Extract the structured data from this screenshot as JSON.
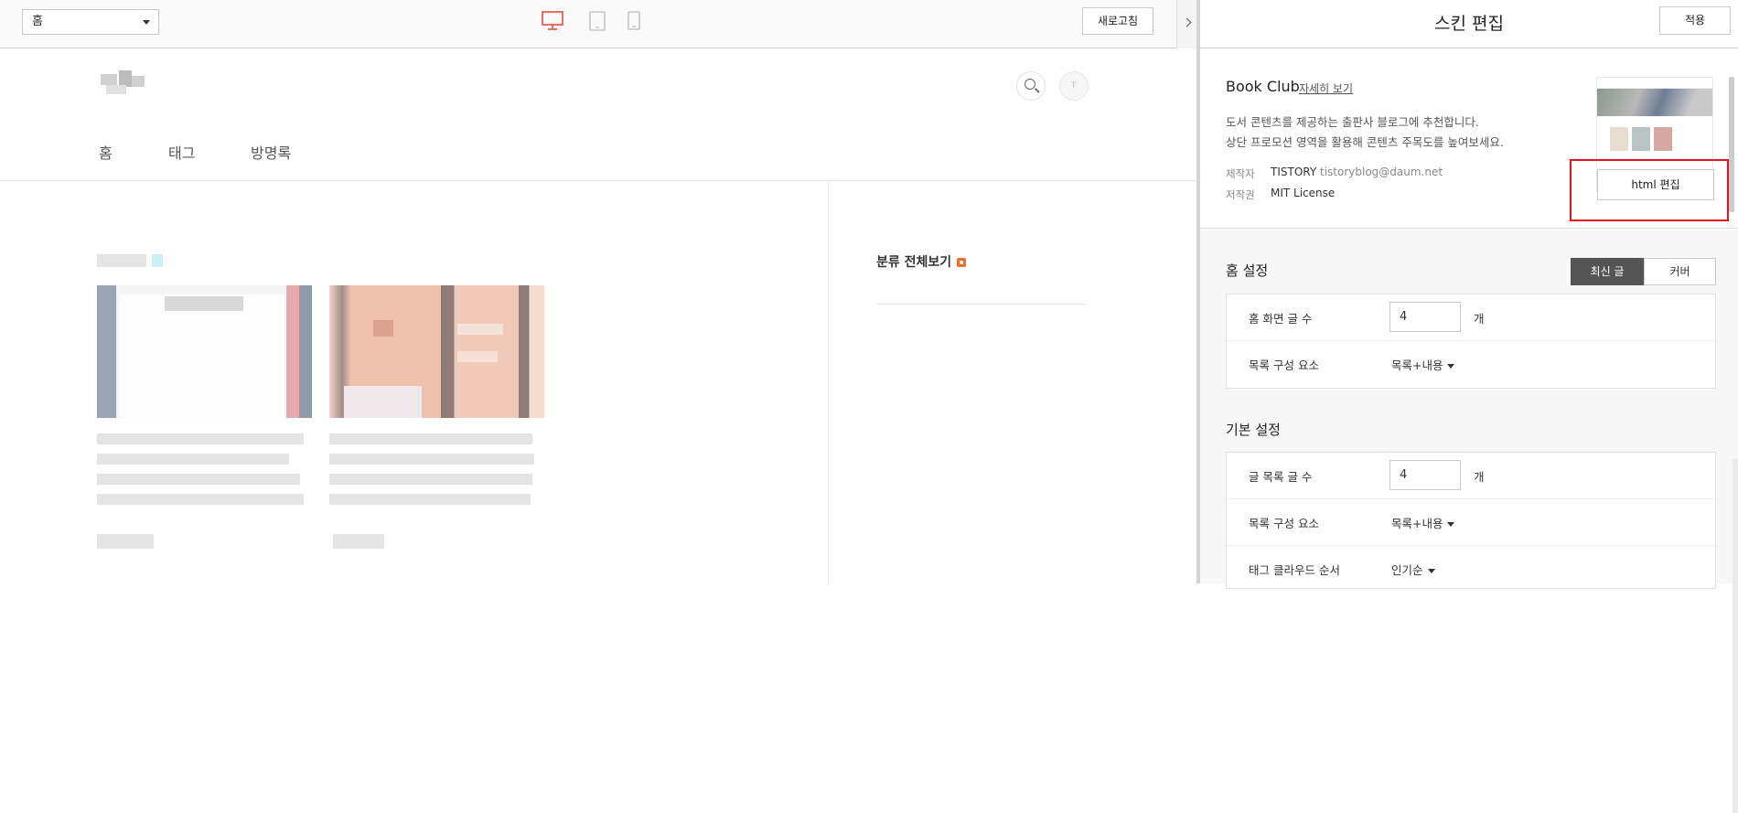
{
  "toolbar": {
    "page_select_value": "홈",
    "refresh_label": "새로고침",
    "device_icons": [
      "desktop-icon",
      "tablet-icon",
      "mobile-icon"
    ],
    "active_device_color": "#e84a3f"
  },
  "blog": {
    "nav": [
      "홈",
      "태그",
      "방명록"
    ],
    "sidebar_category_label": "분류 전체보기",
    "rss_color": "#f26f2c"
  },
  "panel": {
    "title": "스킨 편집",
    "apply_label": "적용",
    "skin": {
      "name": "Book Club",
      "detail_link": "자세히 보기",
      "desc1": "도서 콘텐츠를 제공하는 출판사 블로그에 추천합니다.",
      "desc2": "상단 프로모션 영역을 활용해 콘텐츠 주목도를 높여보세요.",
      "maker_label": "제작자",
      "maker_name": "TISTORY",
      "maker_email": "tistoryblog@daum.net",
      "license_label": "저작권",
      "license_value": "MIT License",
      "html_edit_label": "html 편집",
      "highlight_color": "#e6141a"
    },
    "home_settings": {
      "title": "홈 설정",
      "tabs": [
        "최신 글",
        "커버"
      ],
      "active_tab": "최신 글",
      "rows": [
        {
          "label": "홈 화면 글 수",
          "value": "4",
          "unit": "개"
        },
        {
          "label": "목록 구성 요소",
          "value": "목록+내용"
        }
      ]
    },
    "basic_settings": {
      "title": "기본 설정",
      "rows": [
        {
          "label": "글 목록 글 수",
          "value": "4",
          "unit": "개"
        },
        {
          "label": "목록 구성 요소",
          "value": "목록+내용"
        },
        {
          "label": "태그 클라우드 순서",
          "value": "인기순"
        }
      ]
    }
  }
}
